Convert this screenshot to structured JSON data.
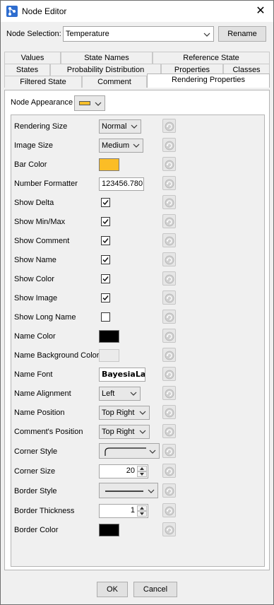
{
  "window": {
    "title": "Node Editor",
    "close_glyph": "✕"
  },
  "node_selection": {
    "label": "Node Selection:",
    "value": "Temperature",
    "rename_label": "Rename"
  },
  "tabs": {
    "row1": [
      "Values",
      "State Names",
      "Reference State"
    ],
    "row2": [
      "States",
      "Probability Distribution",
      "Properties",
      "Classes"
    ],
    "row3": [
      "Filtered State",
      "Comment",
      "Rendering Properties"
    ]
  },
  "appearance": {
    "label": "Node Appearance",
    "color": "#f5be2a"
  },
  "properties": {
    "rendering_size": {
      "label": "Rendering Size",
      "value": "Normal"
    },
    "image_size": {
      "label": "Image Size",
      "value": "Medium"
    },
    "bar_color": {
      "label": "Bar Color",
      "color": "#fbbd26"
    },
    "number_formatter": {
      "label": "Number Formatter",
      "value": "123456.780"
    },
    "show_delta": {
      "label": "Show Delta",
      "checked": true
    },
    "show_minmax": {
      "label": "Show Min/Max",
      "checked": true
    },
    "show_comment": {
      "label": "Show Comment",
      "checked": true
    },
    "show_name": {
      "label": "Show Name",
      "checked": true
    },
    "show_color": {
      "label": "Show Color",
      "checked": true
    },
    "show_image": {
      "label": "Show Image",
      "checked": true
    },
    "show_long_name": {
      "label": "Show Long Name",
      "checked": false
    },
    "name_color": {
      "label": "Name Color",
      "color": "#000000"
    },
    "name_bg_color": {
      "label": "Name Background Color",
      "color": "#ebebeb"
    },
    "name_font": {
      "label": "Name Font",
      "value": "BayesiaLab"
    },
    "name_alignment": {
      "label": "Name Alignment",
      "value": "Left"
    },
    "name_position": {
      "label": "Name Position",
      "value": "Top Right"
    },
    "comment_position": {
      "label": "Comment's Position",
      "value": "Top Right"
    },
    "corner_style": {
      "label": "Corner Style"
    },
    "corner_size": {
      "label": "Corner Size",
      "value": "20"
    },
    "border_style": {
      "label": "Border Style"
    },
    "border_thickness": {
      "label": "Border Thickness",
      "value": "1"
    },
    "border_color": {
      "label": "Border Color",
      "color": "#000000"
    }
  },
  "footer": {
    "ok_label": "OK",
    "cancel_label": "Cancel"
  },
  "icons": {
    "reset": "reset-icon",
    "app": "node-editor-icon",
    "dropdown": "chevron-down-icon"
  }
}
